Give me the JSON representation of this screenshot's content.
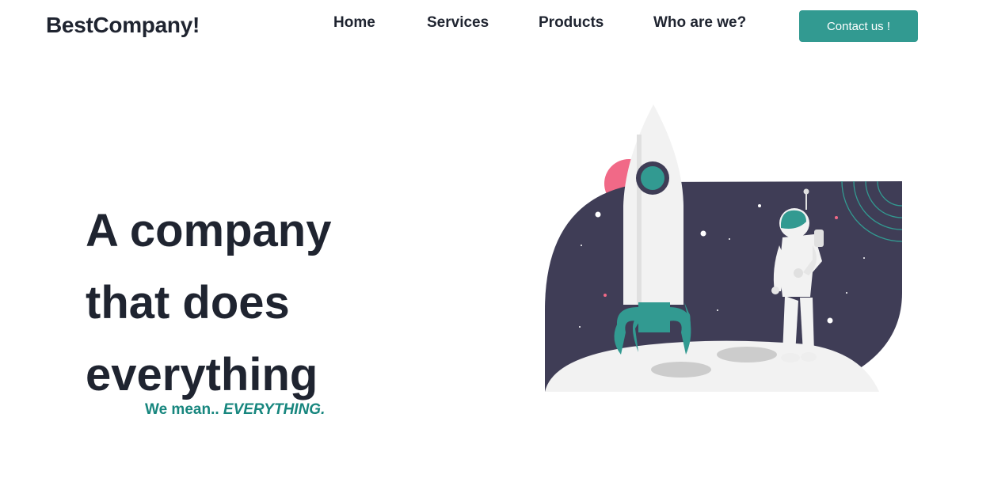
{
  "brand": {
    "name": "BestCompany!"
  },
  "nav": {
    "items": [
      {
        "label": "Home"
      },
      {
        "label": "Services"
      },
      {
        "label": "Products"
      },
      {
        "label": "Who are we?"
      }
    ],
    "cta_label": "Contact us !"
  },
  "hero": {
    "title_lines": [
      "A company",
      "that does",
      "everything"
    ],
    "tagline_prefix": "We mean.. ",
    "tagline_emphasis": "EVERYTHING."
  },
  "colors": {
    "accent": "#329a91",
    "accent_text": "#17867e",
    "dark_text": "#1f2430",
    "space_bg": "#3f3d56",
    "planet_pink": "#f16987",
    "moon": "#f2f2f2"
  },
  "illustration": {
    "name": "rocket-astronaut-moon"
  }
}
